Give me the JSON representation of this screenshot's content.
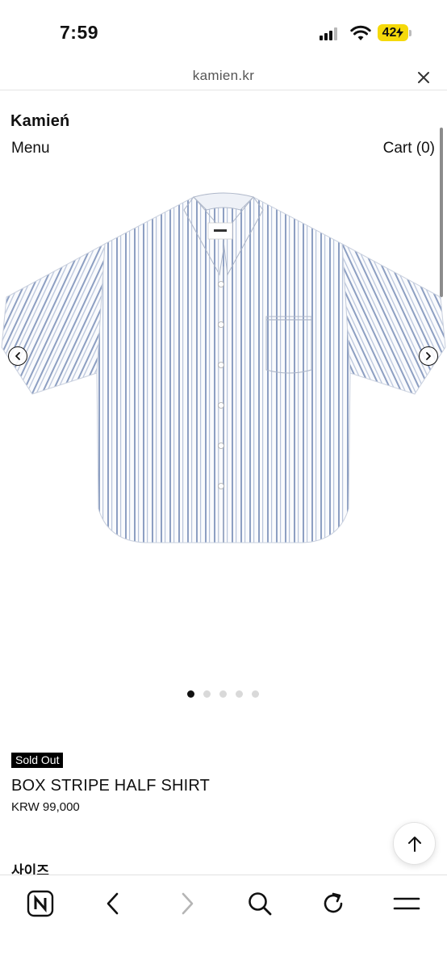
{
  "status_bar": {
    "time": "7:59",
    "battery_level": "42",
    "battery_color": "#f5d90a",
    "icons": [
      "cellular-signal-icon",
      "wifi-icon",
      "battery-icon"
    ]
  },
  "browser": {
    "url": "kamien.kr",
    "close_icon": "close-icon"
  },
  "site": {
    "brand": "Kamień",
    "menu_label": "Menu",
    "cart_label": "Cart (0)"
  },
  "gallery": {
    "image_subject": "white shirt with blue vertical stripes",
    "current_slide": 1,
    "total_slides": 5,
    "prev_icon": "chevron-left-circle-icon",
    "next_icon": "chevron-right-circle-icon"
  },
  "product": {
    "badge": "Sold Out",
    "title": "BOX STRIPE HALF SHIRT",
    "price": "KRW 99,000",
    "size_label": "사이즈"
  },
  "toolbar": {
    "items": [
      "naver-n-icon",
      "back-icon",
      "forward-icon",
      "search-icon",
      "reload-icon",
      "menu-icon"
    ]
  },
  "colors": {
    "stripe_blue": "#8d9fc2",
    "text": "#111111",
    "badge_bg": "#000000"
  }
}
